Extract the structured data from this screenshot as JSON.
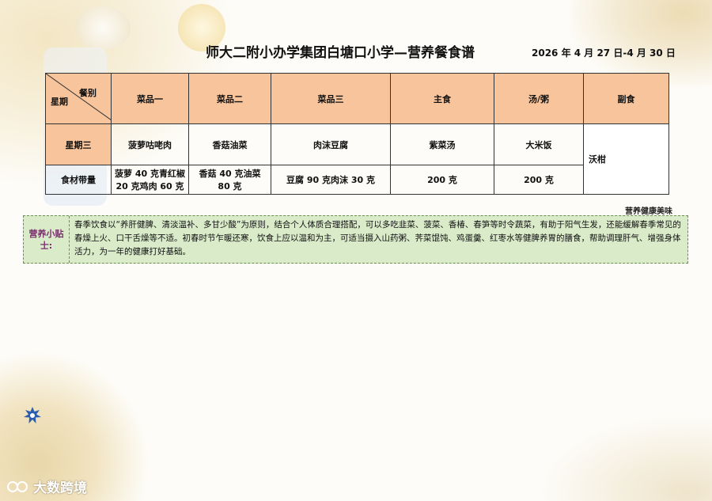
{
  "title": "师大二附小办学集团白塘口小学—营养餐食谱",
  "date_range": "2026 年 4 月 27 日-4 月 30 日",
  "table": {
    "corner_top": "餐别",
    "corner_bottom": "星期",
    "headers": [
      "菜品一",
      "菜品二",
      "菜品三",
      "主食",
      "汤/粥",
      "副食"
    ],
    "rows": [
      {
        "label": "星期三",
        "cells": [
          "菠萝咕咾肉",
          "香菇油菜",
          "肉沫豆腐",
          "紫菜汤",
          "大米饭"
        ]
      },
      {
        "label": "食材带量",
        "cells": [
          "菠萝 40 克青红椒 20 克鸡肉 60 克",
          "香菇 40 克油菜 80 克",
          "豆腐 90 克肉沫 30 克",
          "200 克",
          "200 克"
        ]
      }
    ],
    "side_dish": "沃柑"
  },
  "more_link": "营养健康美味",
  "tips": {
    "label": "营养小贴士:",
    "text": "春季饮食以“养肝健脾、清淡温补、多甘少酸”为原则，结合个人体质合理搭配，可以多吃韭菜、菠菜、香椿、春笋等时令蔬菜，有助于阳气生发，还能缓解春季常见的春燥上火、口干舌燥等不适。初春时节乍暖还寒，饮食上应以温和为主，可适当摄入山药粥、荠菜馄饨、鸡蛋羹、红枣水等健脾养胃的膳食，帮助调理肝气、增强身体活力，为一年的健康打好基础。"
  },
  "watermark": "大数跨境",
  "colors": {
    "header_bg": "#f8c49b",
    "tips_bg": "#d9ebc9",
    "tips_label": "#7a2d6e"
  },
  "icons": [
    "star-badge-icon",
    "watermark-logo-icon"
  ]
}
